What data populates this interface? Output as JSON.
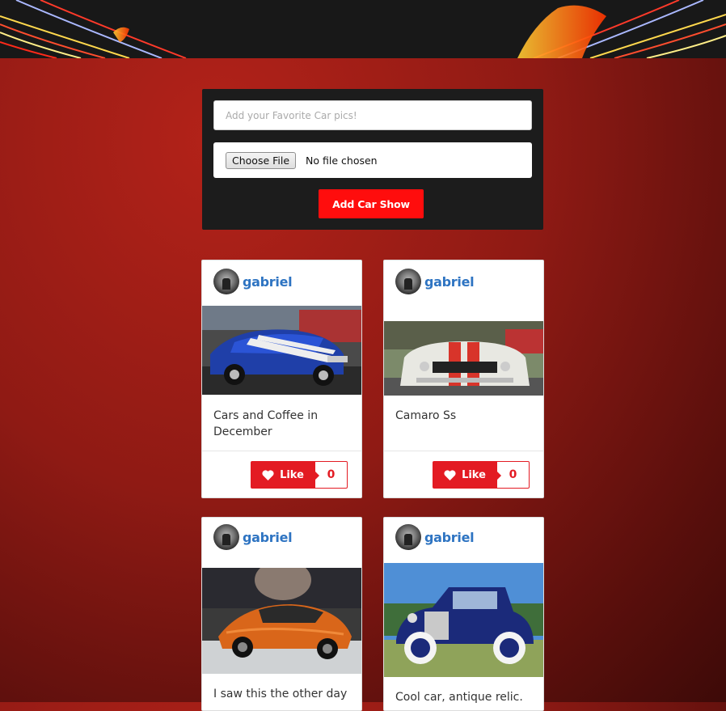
{
  "form": {
    "placeholder": "Add your Favorite Car pics!",
    "file_button": "Choose File",
    "file_status": "No file chosen",
    "submit_label": "Add Car Show"
  },
  "colors": {
    "accent": "#ff0d0d",
    "like": "#e31b23",
    "username": "#2e74c2"
  },
  "posts": [
    {
      "username": "gabriel",
      "caption": "Cars and Coffee in December",
      "like_label": "Like",
      "likes": "0",
      "image": "blue-chevelle-photo"
    },
    {
      "username": "gabriel",
      "caption": "Camaro Ss",
      "like_label": "Like",
      "likes": "0",
      "image": "white-camaro-photo"
    },
    {
      "username": "gabriel",
      "caption": "I saw this the other day",
      "image": "orange-jaguar-photo"
    },
    {
      "username": "gabriel",
      "caption": "Cool car, antique relic.",
      "image": "blue-antique-car-photo"
    }
  ]
}
